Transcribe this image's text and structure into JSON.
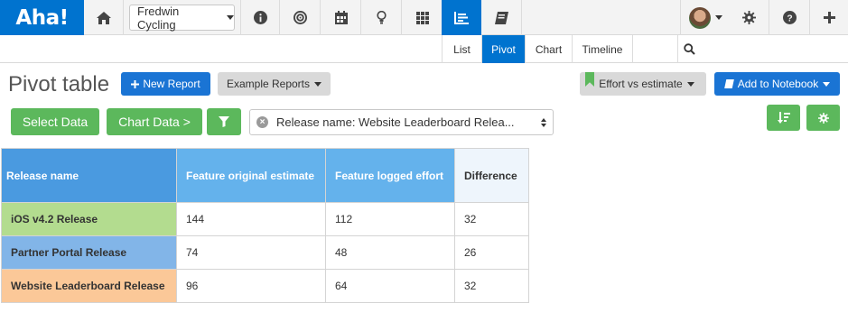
{
  "app": {
    "logo": "Aha!"
  },
  "topnav": {
    "workspace": "Fredwin Cycling",
    "icons": [
      "home-icon",
      "info-icon",
      "goals-icon",
      "calendar-icon",
      "ideas-icon",
      "features-icon",
      "reports-icon",
      "notebooks-icon",
      "settings-icon",
      "help-icon",
      "add-icon"
    ]
  },
  "subnav": {
    "tabs": [
      {
        "label": "List"
      },
      {
        "label": "Pivot"
      },
      {
        "label": "Chart"
      },
      {
        "label": "Timeline"
      }
    ],
    "active_tab": "Pivot"
  },
  "toolbar": {
    "title": "Pivot table",
    "new_report": "New Report",
    "example_reports": "Example Reports",
    "saved_view": "Effort vs estimate",
    "add_to_notebook": "Add to Notebook",
    "select_data": "Select Data",
    "chart_data": "Chart Data >",
    "filter_value": "Release name: Website Leaderboard Relea..."
  },
  "colors": {
    "brand": "#0073cf",
    "primary_button": "#1a74d4",
    "success_button": "#5cb85c",
    "header_dark": "#4a9ae0",
    "header_light": "#64b2ec"
  },
  "pivot": {
    "headers": [
      "Release name",
      "Feature original estimate",
      "Feature logged effort",
      "Difference"
    ],
    "rows": [
      {
        "name": "iOS v4.2 Release",
        "estimate": "144",
        "logged": "112",
        "difference": "32",
        "color": "#b3dc8f"
      },
      {
        "name": "Partner Portal Release",
        "estimate": "74",
        "logged": "48",
        "difference": "26",
        "color": "#82b5e8"
      },
      {
        "name": "Website Leaderboard Release",
        "estimate": "96",
        "logged": "64",
        "difference": "32",
        "color": "#fbc898"
      }
    ]
  }
}
